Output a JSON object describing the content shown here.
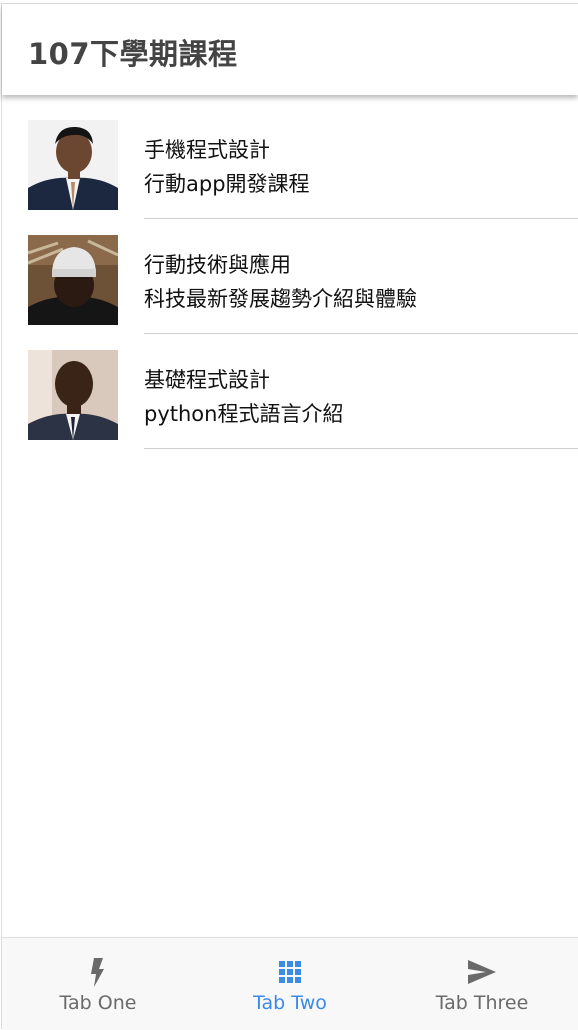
{
  "header": {
    "title": "107下學期課程"
  },
  "courses": [
    {
      "title": "手機程式設計",
      "subtitle": "行動app開發課程",
      "avatar_icon": "instructor-avatar-1"
    },
    {
      "title": "行動技術與應用",
      "subtitle": "科技最新發展趨勢介紹與體驗",
      "avatar_icon": "instructor-avatar-2"
    },
    {
      "title": "基礎程式設計",
      "subtitle": "python程式語言介紹",
      "avatar_icon": "instructor-avatar-3"
    }
  ],
  "tabs": [
    {
      "label": "Tab One",
      "icon": "lightning-icon",
      "active": false
    },
    {
      "label": "Tab Two",
      "icon": "grid-icon",
      "active": true
    },
    {
      "label": "Tab Three",
      "icon": "send-icon",
      "active": false
    }
  ],
  "colors": {
    "accent": "#3b8ae6",
    "inactive_tab": "#6a6a6a",
    "title_text": "#444444"
  }
}
